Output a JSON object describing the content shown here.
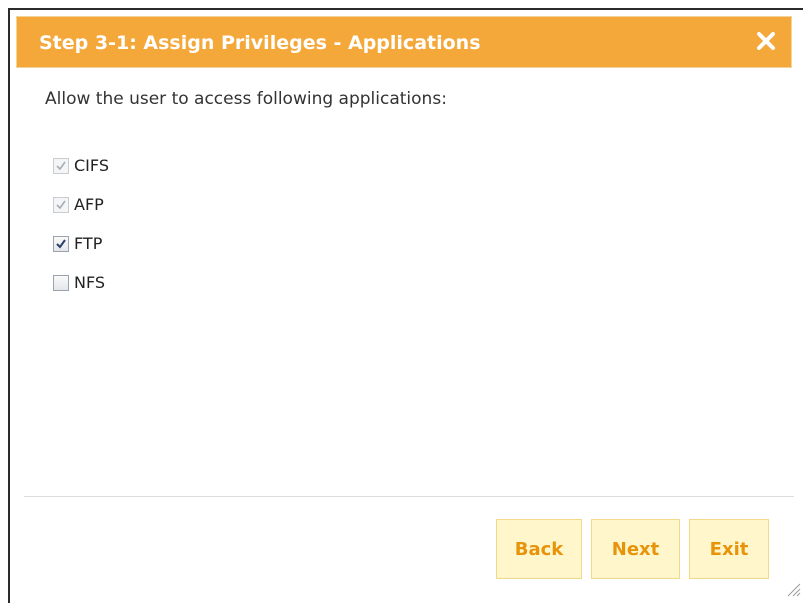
{
  "dialog": {
    "title": "Step 3-1: Assign Privileges - Applications",
    "close_icon": "close-icon"
  },
  "prompt": "Allow the user to access following applications:",
  "applications": [
    {
      "label": "CIFS",
      "checked": true,
      "disabled": true
    },
    {
      "label": "AFP",
      "checked": true,
      "disabled": true
    },
    {
      "label": "FTP",
      "checked": true,
      "disabled": false
    },
    {
      "label": "NFS",
      "checked": false,
      "disabled": false
    }
  ],
  "buttons": {
    "back": "Back",
    "next": "Next",
    "exit": "Exit"
  },
  "colors": {
    "titlebar": "#f5a83a",
    "button_bg": "#fff6cc",
    "button_text": "#e8940a"
  }
}
